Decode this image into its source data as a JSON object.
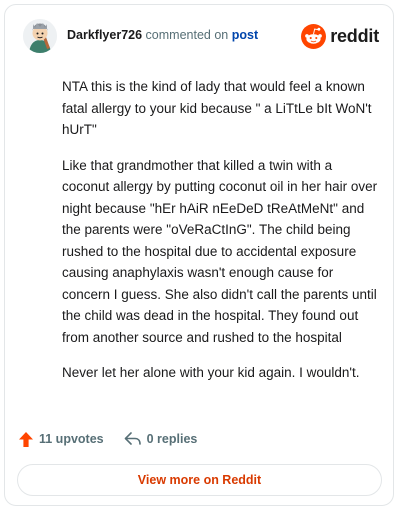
{
  "header": {
    "username": "Darkflyer726",
    "action_text": "commented on",
    "post_link": "post",
    "brand": "reddit",
    "brand_color": "#ff4500"
  },
  "comment": {
    "paragraphs": [
      "NTA this is the kind of lady that would feel a known fatal allergy to your kid because \" a LiTtLe bIt WoN't hUrT\"",
      "Like that grandmother that killed a twin with a coconut allergy by putting coconut oil in her hair over night because \"hEr hAiR nEeDeD tReAtMeNt\" and the parents were \"oVeRaCtInG\". The child being rushed to the hospital due to accidental exposure causing anaphylaxis wasn't enough cause for concern I guess. She also didn't call the parents until the child was dead in the hospital. They found out from another source and rushed to the hospital",
      "Never let her alone with your kid again. I wouldn't."
    ]
  },
  "actions": {
    "upvotes": "11 upvotes",
    "replies": "0 replies",
    "upvote_icon": "upvote-arrow-icon",
    "reply_icon": "reply-arrow-icon",
    "upvote_color": "#ff4500"
  },
  "view_more": {
    "label": "View more on Reddit",
    "color": "#d93a00"
  }
}
